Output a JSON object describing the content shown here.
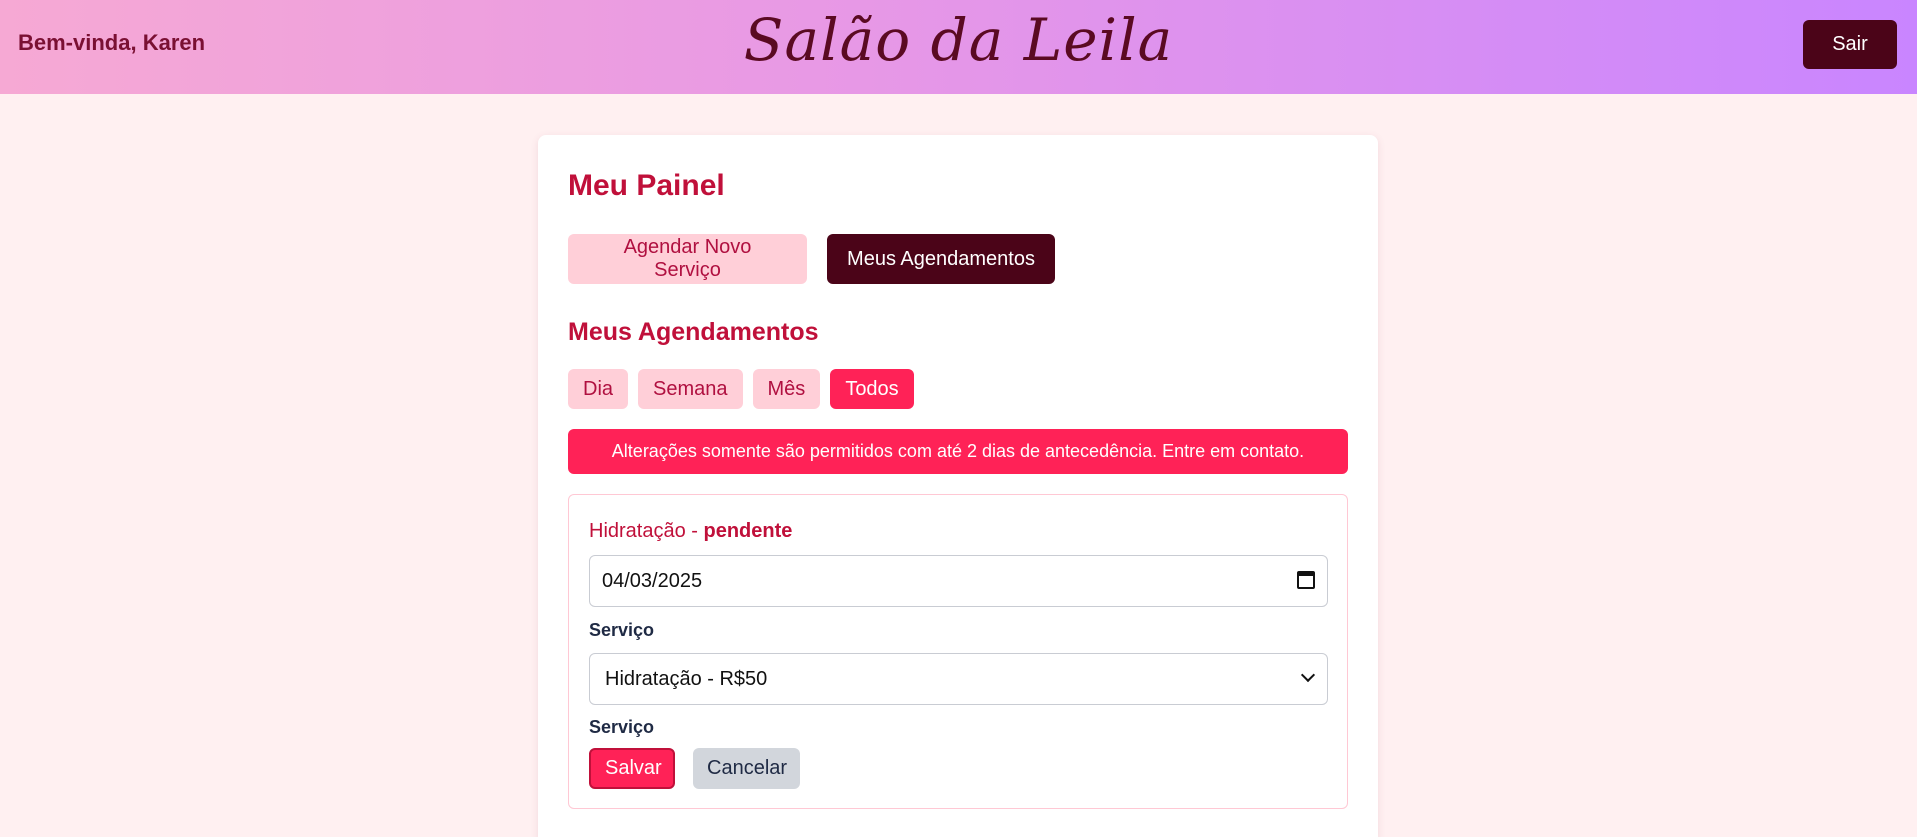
{
  "header": {
    "greeting": "Bem-vinda, Karen",
    "brand": "Salão da Leila",
    "logout_label": "Sair"
  },
  "panel": {
    "title": "Meu Painel",
    "tabs": [
      {
        "label": "Agendar Novo Serviço",
        "active": false
      },
      {
        "label": "Meus Agendamentos",
        "active": true
      }
    ]
  },
  "appointments": {
    "title": "Meus Agendamentos",
    "filters": [
      {
        "label": "Dia",
        "active": false
      },
      {
        "label": "Semana",
        "active": false
      },
      {
        "label": "Mês",
        "active": false
      },
      {
        "label": "Todos",
        "active": true
      }
    ],
    "notice": "Alterações somente são permitidos com até 2 dias de antecedência. Entre em contato."
  },
  "booking": {
    "service_name": "Hidratação",
    "separator": " - ",
    "status": "pendente",
    "date": "04/03/2025",
    "service_label": "Serviço",
    "selected_service": "Hidratação - R$50",
    "second_label": "Serviço",
    "save_label": "Salvar",
    "cancel_label": "Cancelar"
  },
  "colors": {
    "accent": "#ff2257",
    "dark": "#4b0418",
    "title": "#c0103a",
    "light_pink": "#ffcfd8"
  },
  "icons": [
    "calendar-icon",
    "chevron-down-icon"
  ]
}
